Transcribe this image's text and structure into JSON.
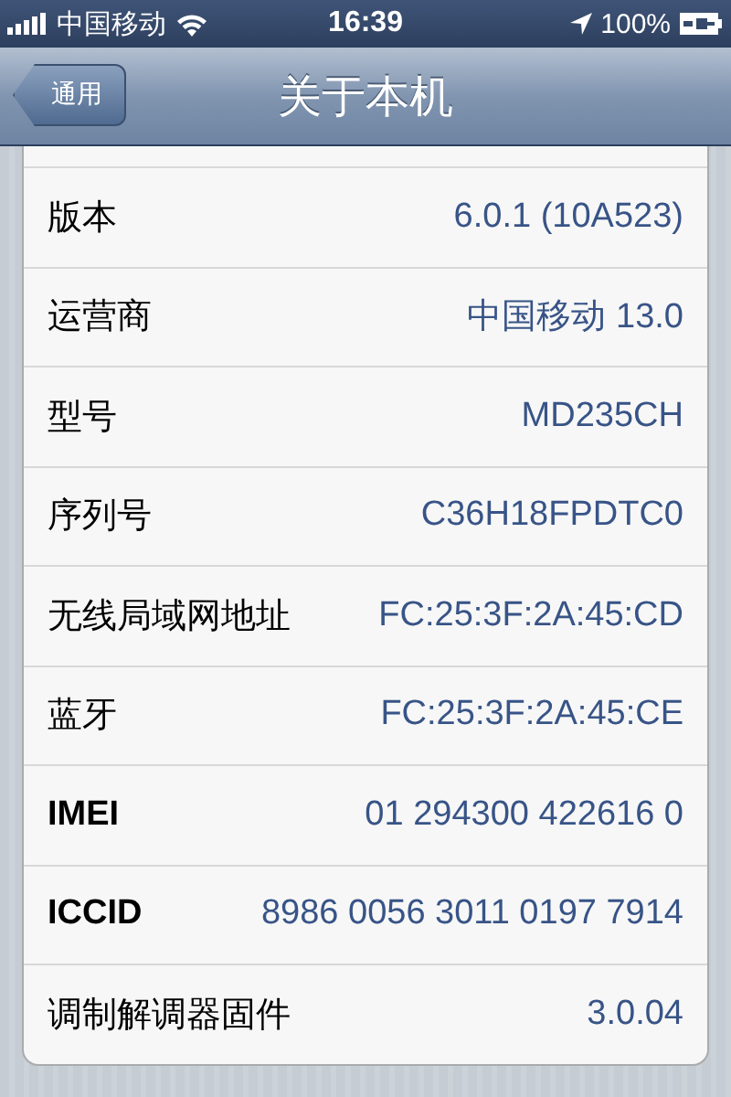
{
  "status_bar": {
    "carrier": "中国移动",
    "time": "16:39",
    "battery": "100%"
  },
  "nav_bar": {
    "back": "通用",
    "title": "关于本机"
  },
  "rows": [
    {
      "label": "版本",
      "value": "6.0.1 (10A523)"
    },
    {
      "label": "运营商",
      "value": "中国移动 13.0"
    },
    {
      "label": "型号",
      "value": "MD235CH"
    },
    {
      "label": "序列号",
      "value": "C36H18FPDTC0"
    },
    {
      "label": "无线局域网地址",
      "value": "FC:25:3F:2A:45:CD"
    },
    {
      "label": "蓝牙",
      "value": "FC:25:3F:2A:45:CE"
    },
    {
      "label": "IMEI",
      "value": "01 294300 422616 0"
    },
    {
      "label": "ICCID",
      "value": "8986 0056 3011 0197 7914"
    },
    {
      "label": "调制解调器固件",
      "value": "3.0.04"
    }
  ]
}
